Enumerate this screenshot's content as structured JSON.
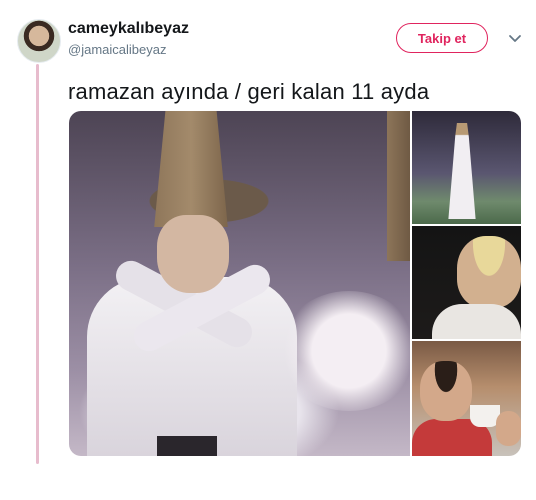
{
  "user": {
    "display_name": "cameykalıbeyaz",
    "handle": "@jamaicalibeyaz"
  },
  "follow_button_label": "Takip et",
  "tweet": {
    "text": "ramazan ayında / geri kalan 11 ayda"
  },
  "icons": {
    "more": "chevron-down-icon"
  },
  "colors": {
    "follow_accent": "#e0245e",
    "thread_line": "#e7bccd"
  }
}
